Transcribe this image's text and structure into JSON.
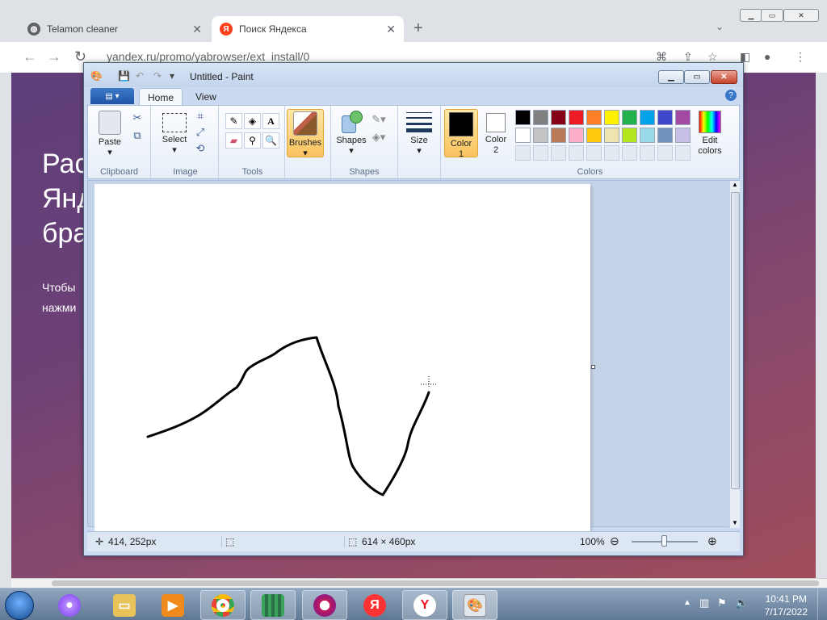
{
  "browser": {
    "tabs": [
      {
        "label": "Telamon cleaner",
        "icon": "globe-icon"
      },
      {
        "label": "Поиск Яндекса",
        "icon": "yandex-icon"
      }
    ],
    "new_tab": "+",
    "address": "yandex.ru/promo/yabrowser/ext_install/0",
    "page": {
      "heading": "Рас\nЯнд\nбра",
      "paragraph": "Чтобы\nнажми"
    }
  },
  "paint": {
    "title": "Untitled - Paint",
    "tabs": {
      "home": "Home",
      "view": "View"
    },
    "groups": {
      "clipboard": {
        "label": "Clipboard",
        "paste": "Paste"
      },
      "image": {
        "label": "Image",
        "select": "Select"
      },
      "tools": {
        "label": "Tools"
      },
      "brushes": {
        "label": "Brushes"
      },
      "shapes": {
        "label": "Shapes",
        "button": "Shapes"
      },
      "size": {
        "label": "Size"
      },
      "colors": {
        "label": "Colors",
        "color1": "Color\n1",
        "color2": "Color\n2",
        "edit": "Edit\ncolors",
        "color1_value": "#000000",
        "color2_value": "#ffffff",
        "palette_row1": [
          "#000000",
          "#7f7f7f",
          "#880015",
          "#ed1c24",
          "#ff7f27",
          "#fff200",
          "#22b14c",
          "#00a2e8",
          "#3f48cc",
          "#a349a4"
        ],
        "palette_row2": [
          "#ffffff",
          "#c3c3c3",
          "#b97a57",
          "#ffaec9",
          "#ffc90e",
          "#efe4b0",
          "#b5e61d",
          "#99d9ea",
          "#7092be",
          "#c8bfe7"
        ]
      }
    },
    "status": {
      "cursor_pos": "414, 252px",
      "canvas_size": "614 × 460px",
      "zoom": "100%"
    }
  },
  "taskbar": {
    "time": "10:41 PM",
    "date": "7/17/2022",
    "apps": [
      "alice-icon",
      "file-explorer-icon",
      "media-player-icon",
      "chrome-icon",
      "app-grid-icon",
      "opera-icon",
      "yandex-icon",
      "yandex-browser-icon",
      "paint-icon"
    ]
  }
}
